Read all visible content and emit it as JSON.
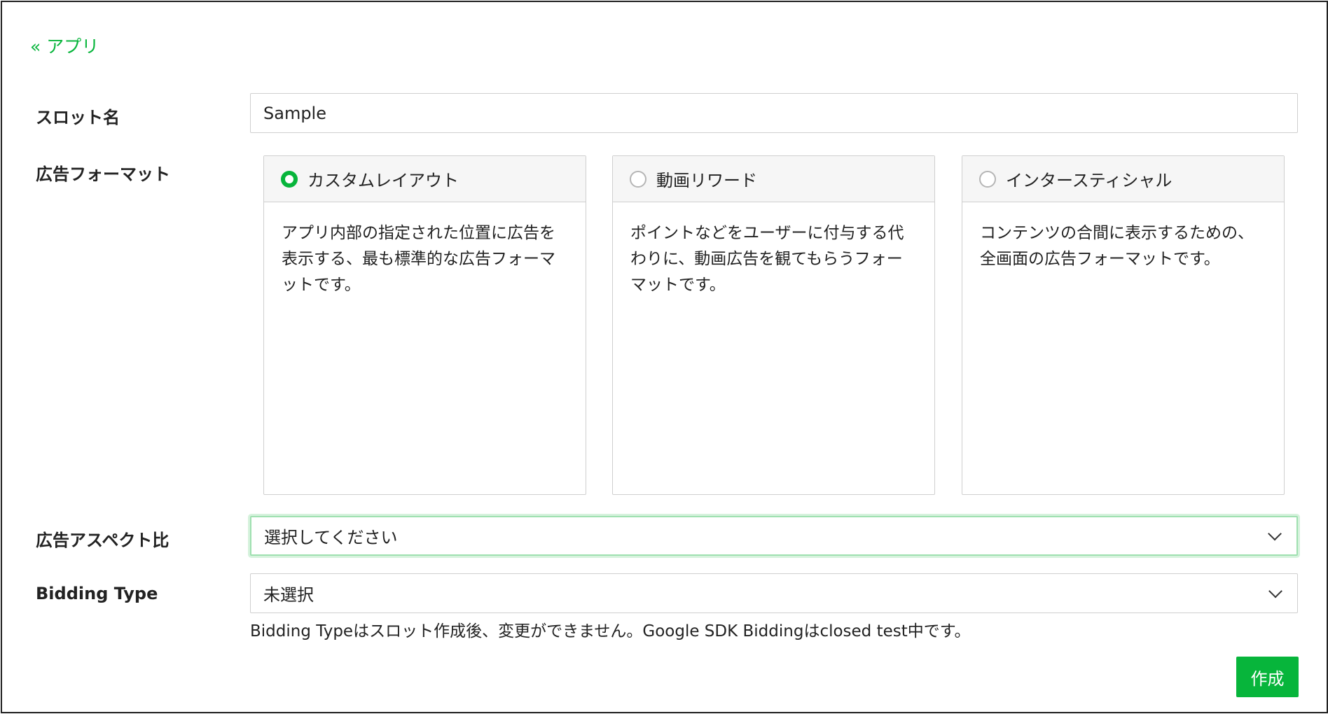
{
  "nav": {
    "back_label": "« アプリ"
  },
  "form": {
    "slot_name": {
      "label": "スロット名",
      "value": "Sample"
    },
    "ad_format": {
      "label": "広告フォーマット",
      "options": [
        {
          "title": "カスタムレイアウト",
          "description": "アプリ内部の指定された位置に広告を表示する、最も標準的な広告フォーマットです。",
          "checked": true
        },
        {
          "title": "動画リワード",
          "description": "ポイントなどをユーザーに付与する代わりに、動画広告を観てもらうフォーマットです。",
          "checked": false
        },
        {
          "title": "インタースティシャル",
          "description": "コンテンツの合間に表示するための、全画面の広告フォーマットです。",
          "checked": false
        }
      ]
    },
    "aspect_ratio": {
      "label": "広告アスペクト比",
      "selected": "選択してください"
    },
    "bidding_type": {
      "label": "Bidding Type",
      "selected": "未選択",
      "help": "Bidding Typeはスロット作成後、変更ができません。Google SDK Biddingはclosed test中です。"
    },
    "submit_label": "作成"
  },
  "colors": {
    "accent": "#07b53b",
    "border": "#cfcfcf",
    "card_header_bg": "#f6f6f6",
    "focus_ring": "#9fe0b0"
  },
  "icons": {
    "radio": "radio-icon",
    "dropdown": "chevron-down-icon"
  }
}
